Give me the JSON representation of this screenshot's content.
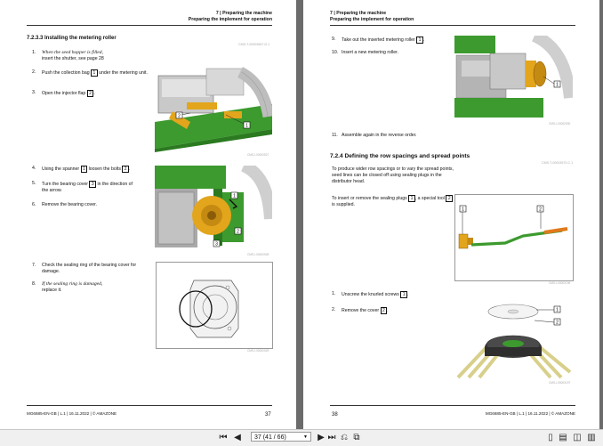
{
  "left_page": {
    "chapter": "7 | Preparing the machine",
    "section": "Preparing the implement for operation",
    "heading": "7.2.3.3 Installing the metering roller",
    "doc_id": "CMS-T-00003567-D.1",
    "steps": [
      {
        "num": "1.",
        "italic": "When the seed hopper is filled,",
        "text": "insert the shutter, see page 28"
      },
      {
        "num": "2.",
        "pre": "Push the collection bag",
        "box": "1",
        "post": "under the metering unit."
      },
      {
        "num": "3.",
        "pre": "Open the injector flap",
        "box": "2",
        "post": "."
      },
      {
        "num": "4.",
        "pre": "Using the spanner",
        "box": "1",
        "post": "loosen the bolts",
        "box2": "2",
        "post2": "."
      },
      {
        "num": "5.",
        "pre": "Turn the bearing cover",
        "box": "3",
        "post": "in the direction of the arrow."
      },
      {
        "num": "6.",
        "text": "Remove the bearing cover."
      },
      {
        "num": "7.",
        "text": "Check the sealing ring of the bearing cover for damage."
      },
      {
        "num": "8.",
        "italic": "If the sealing ring is damaged,",
        "text": "replace it."
      }
    ],
    "figure_codes": [
      "CMS-I-00002527",
      "CMS-I-00002528",
      "CMS-I-00002529"
    ],
    "footer": "MG6685-EN-GB | L.1 | 16.11.2022 | © AMAZONE",
    "page_number": "37"
  },
  "right_page": {
    "chapter": "7 | Preparing the machine",
    "section": "Preparing the implement for operation",
    "steps_top": [
      {
        "num": "9.",
        "pre": "Take out the inserted metering roller",
        "box": "1",
        "post": "."
      },
      {
        "num": "10.",
        "text": "Insert a new metering roller."
      },
      {
        "num": "11.",
        "text": "Assemble again in the reverse order."
      }
    ],
    "heading": "7.2.4  Defining the row spacings and spread points",
    "doc_id": "CMS-T-00003570-C.1",
    "intro": "To produce wider row spacings or to vary the spread points, seed lines can be closed off using sealing plugs in the distributor head.",
    "insert_pre": "To insert or remove the sealing plugs",
    "insert_box1": "1",
    "insert_mid": ", a special tool",
    "insert_box2": "2",
    "insert_post": "is supplied.",
    "steps_bottom": [
      {
        "num": "1.",
        "pre": "Unscrew the knurled screws",
        "box": "1",
        "post": "."
      },
      {
        "num": "2.",
        "pre": "Remove the cover",
        "box": "2",
        "post": "."
      }
    ],
    "figure_codes": [
      "CMS-I-00002530",
      "CMS-I-00003196",
      "CMS-I-00003197"
    ],
    "footer": "MG6685-EN-GB | L.1 | 16.11.2022 | © AMAZONE",
    "page_number": "38"
  },
  "toolbar": {
    "page_indicator": "37 (41 / 66)"
  },
  "colors": {
    "machine_green": "#3c9a2e",
    "part_yellow": "#e3a51c",
    "page_bg": "#ffffff",
    "viewer_bg": "#6b6b6b"
  }
}
